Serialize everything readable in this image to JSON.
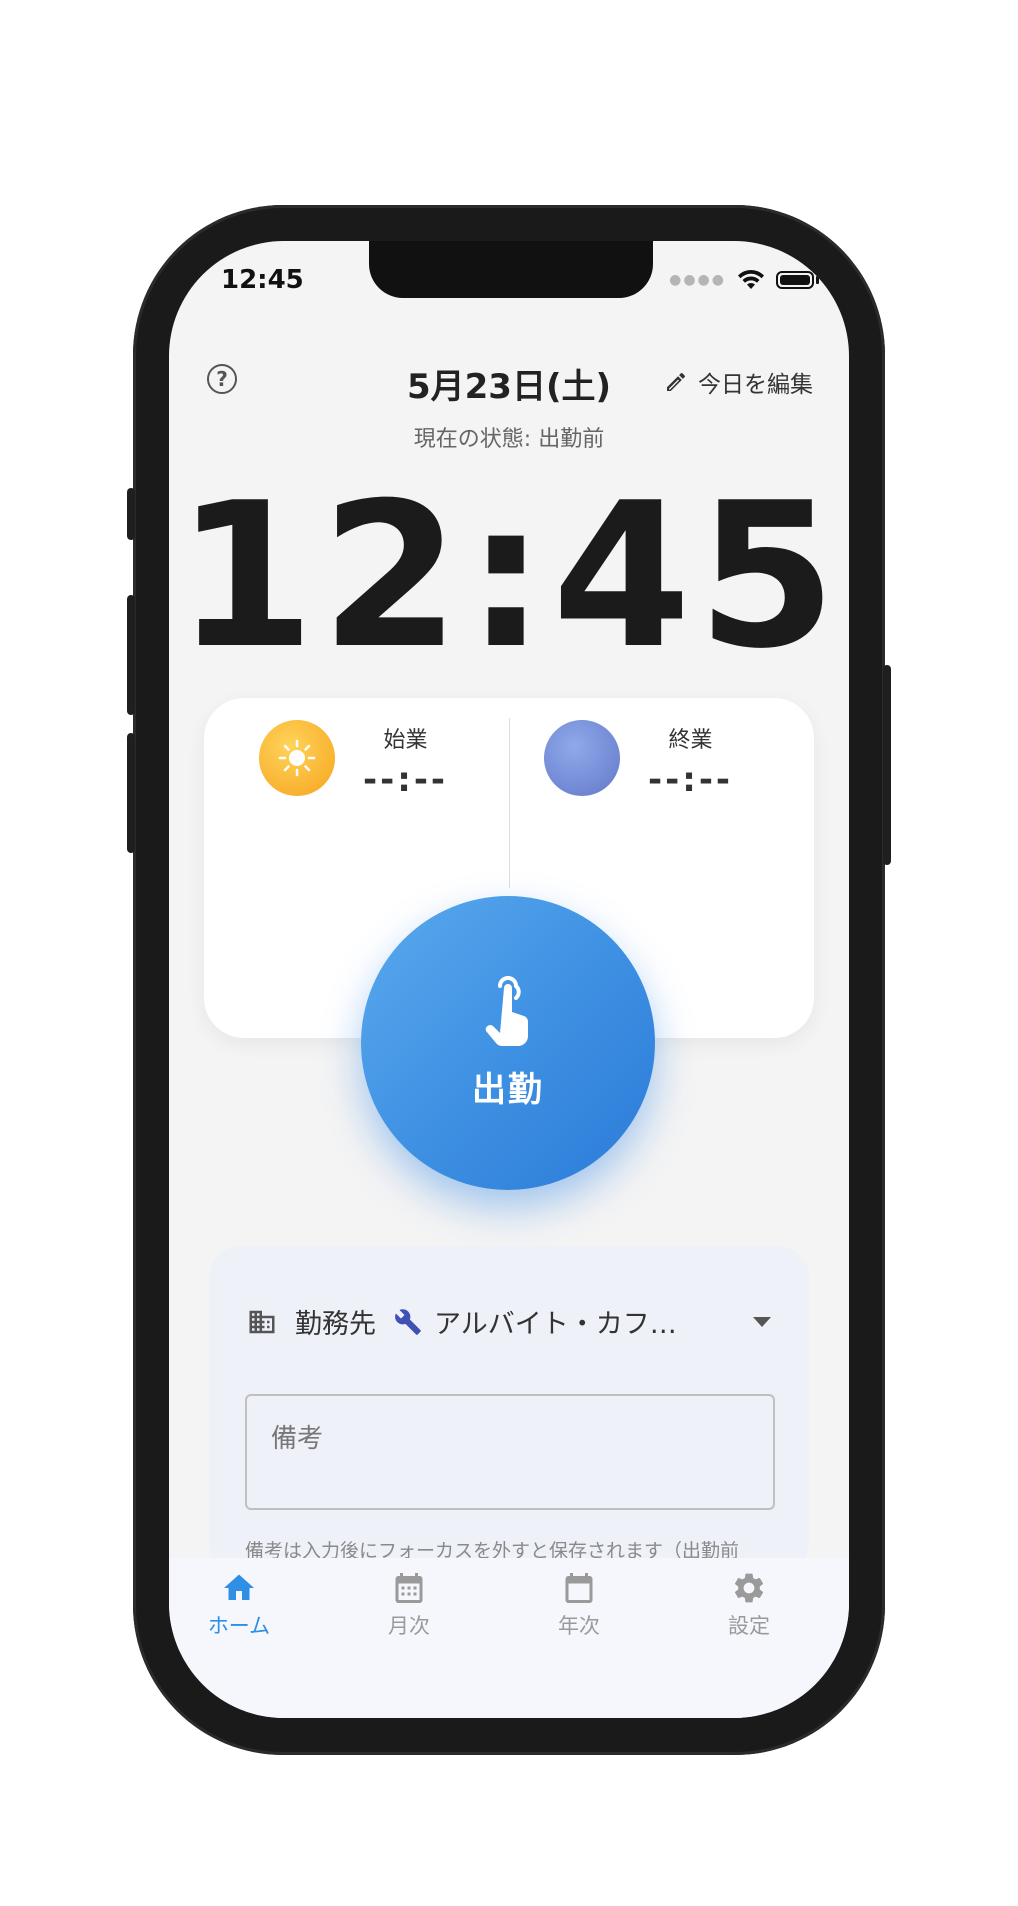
{
  "status_bar": {
    "time": "12:45"
  },
  "header": {
    "date": "5月23日(土)",
    "edit_label": "今日を編集",
    "state": "現在の状態: 出勤前"
  },
  "clock": {
    "time": "12:45"
  },
  "card": {
    "start": {
      "label": "始業",
      "time": "--:--"
    },
    "end": {
      "label": "終業",
      "time": "--:--"
    }
  },
  "punch_button": {
    "label": "出勤"
  },
  "workplace": {
    "label": "勤務先",
    "value": "アルバイト・カフ…"
  },
  "memo": {
    "placeholder": "備考",
    "hint": "備考は入力後にフォーカスを外すと保存されます（出勤前"
  },
  "tabs": [
    {
      "label": "ホーム",
      "icon": "home-icon",
      "active": true
    },
    {
      "label": "月次",
      "icon": "calendar-month-icon",
      "active": false
    },
    {
      "label": "年次",
      "icon": "calendar-icon",
      "active": false
    },
    {
      "label": "設定",
      "icon": "gear-icon",
      "active": false
    }
  ],
  "colors": {
    "accent": "#2f8fe5",
    "punch_button": "#3d8fe2",
    "sun": "#f6a41e",
    "moon": "#6378c9"
  }
}
